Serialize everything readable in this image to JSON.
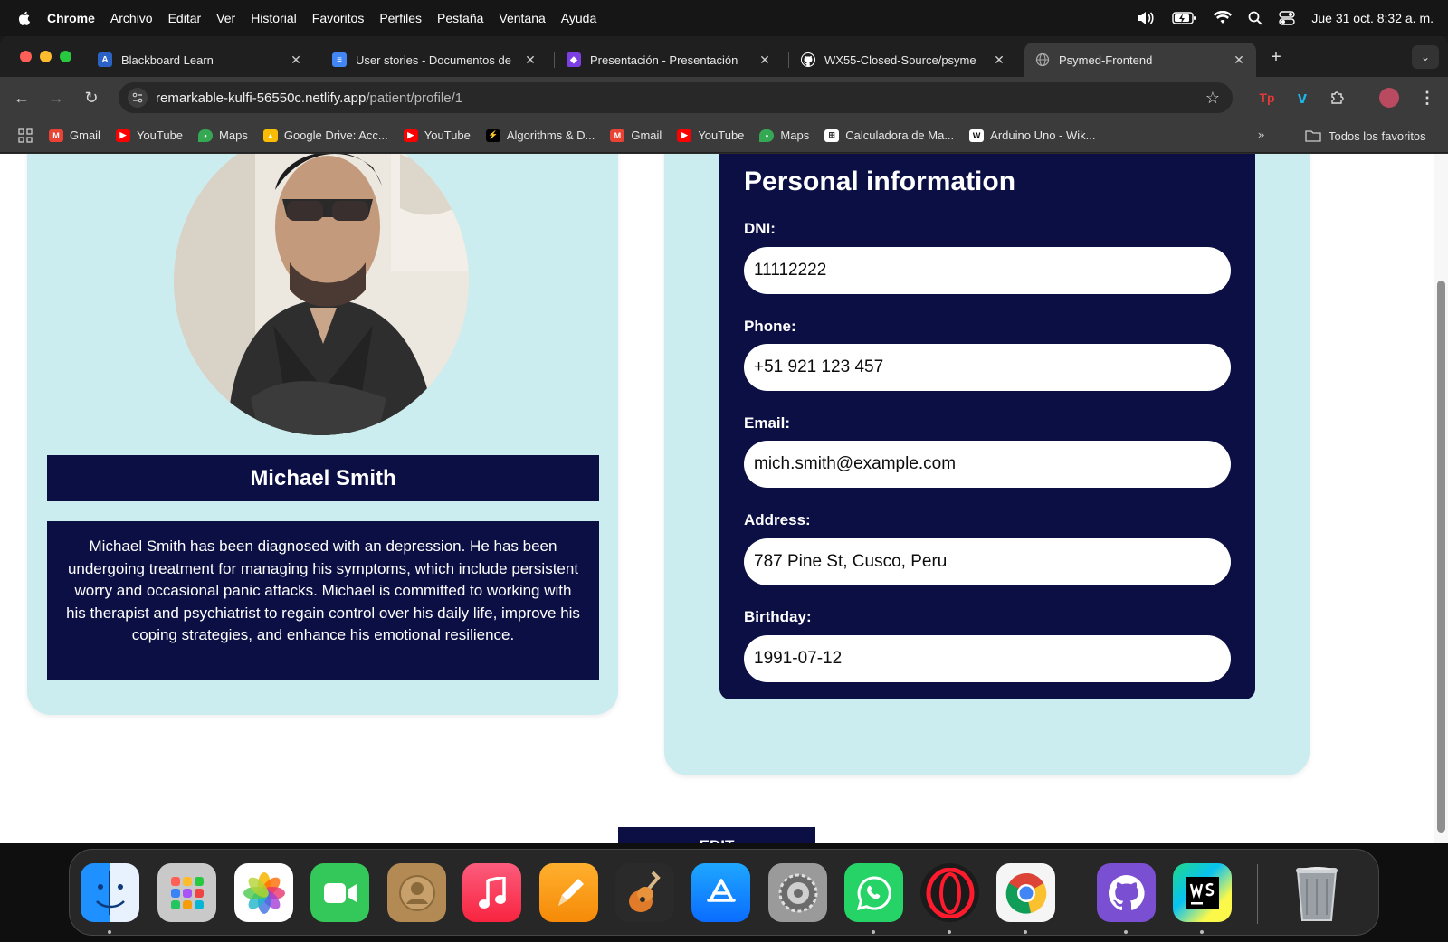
{
  "menubar": {
    "app_name": "Chrome",
    "menus": [
      "Archivo",
      "Editar",
      "Ver",
      "Historial",
      "Favoritos",
      "Perfiles",
      "Pestaña",
      "Ventana",
      "Ayuda"
    ],
    "datetime": "Jue 31 oct.  8:32 a. m."
  },
  "tabs": [
    {
      "label": "Blackboard Learn",
      "icon": "blackboard-icon",
      "color": "#2a63c5"
    },
    {
      "label": "User stories - Documentos de",
      "icon": "google-docs-icon",
      "color": "#4285f4"
    },
    {
      "label": "Presentación - Presentación",
      "icon": "canva-icon",
      "color": "#7b3fe4"
    },
    {
      "label": "WX55-Closed-Source/psyme",
      "icon": "github-icon",
      "color": "#ffffff"
    },
    {
      "label": "Psymed-Frontend",
      "icon": "globe-icon",
      "color": "#9aa0a6",
      "active": true
    }
  ],
  "address_bar": {
    "host": "remarkable-kulfi-56550c.netlify.app",
    "path": "/patient/profile/1"
  },
  "bookmarks": [
    {
      "label": "Gmail",
      "icon": "gmail-icon",
      "color": "#ea4335"
    },
    {
      "label": "YouTube",
      "icon": "youtube-icon",
      "color": "#ff0000"
    },
    {
      "label": "Maps",
      "icon": "maps-icon",
      "color": "#34a853"
    },
    {
      "label": "Google Drive: Acc...",
      "icon": "drive-icon",
      "color": "#fbbc04"
    },
    {
      "label": "YouTube",
      "icon": "youtube-icon",
      "color": "#ff0000"
    },
    {
      "label": "Algorithms & D...",
      "icon": "algorithms-icon",
      "color": "#000000"
    },
    {
      "label": "Gmail",
      "icon": "gmail-icon",
      "color": "#ea4335"
    },
    {
      "label": "YouTube",
      "icon": "youtube-icon",
      "color": "#ff0000"
    },
    {
      "label": "Maps",
      "icon": "maps-icon",
      "color": "#34a853"
    },
    {
      "label": "Calculadora de Ma...",
      "icon": "calculator-icon",
      "color": "#ffffff"
    },
    {
      "label": "Arduino Uno - Wik...",
      "icon": "wikipedia-icon",
      "color": "#ffffff"
    }
  ],
  "bookmarks_all": "Todos los favoritos",
  "profile": {
    "name": "Michael Smith",
    "bio": "Michael Smith has been diagnosed with an depression. He has been undergoing treatment for managing his symptoms, which include persistent worry and occasional panic attacks. Michael is committed to working with his therapist and psychiatrist to regain control over his daily life, improve his coping strategies, and enhance his emotional resilience."
  },
  "personal_info": {
    "title": "Personal information",
    "dni_label": "DNI:",
    "dni_value": "11112222",
    "phone_label": "Phone:",
    "phone_value": "+51 921 123 457",
    "email_label": "Email:",
    "email_value": "mich.smith@example.com",
    "address_label": "Address:",
    "address_value": "787 Pine St, Cusco, Peru",
    "birthday_label": "Birthday:",
    "birthday_value": "1991-07-12"
  },
  "edit_button": "EDIT",
  "colors": {
    "navy": "#0c0f44",
    "card_bg": "#cbedef"
  },
  "dock": [
    "finder-icon",
    "launchpad-icon",
    "photos-icon",
    "facetime-icon",
    "contacts-icon",
    "music-icon",
    "pages-icon",
    "garageband-icon",
    "app-store-icon",
    "system-settings-icon",
    "whatsapp-icon",
    "opera-icon",
    "chrome-icon",
    "github-desktop-icon",
    "webstorm-icon",
    "trash-icon"
  ]
}
